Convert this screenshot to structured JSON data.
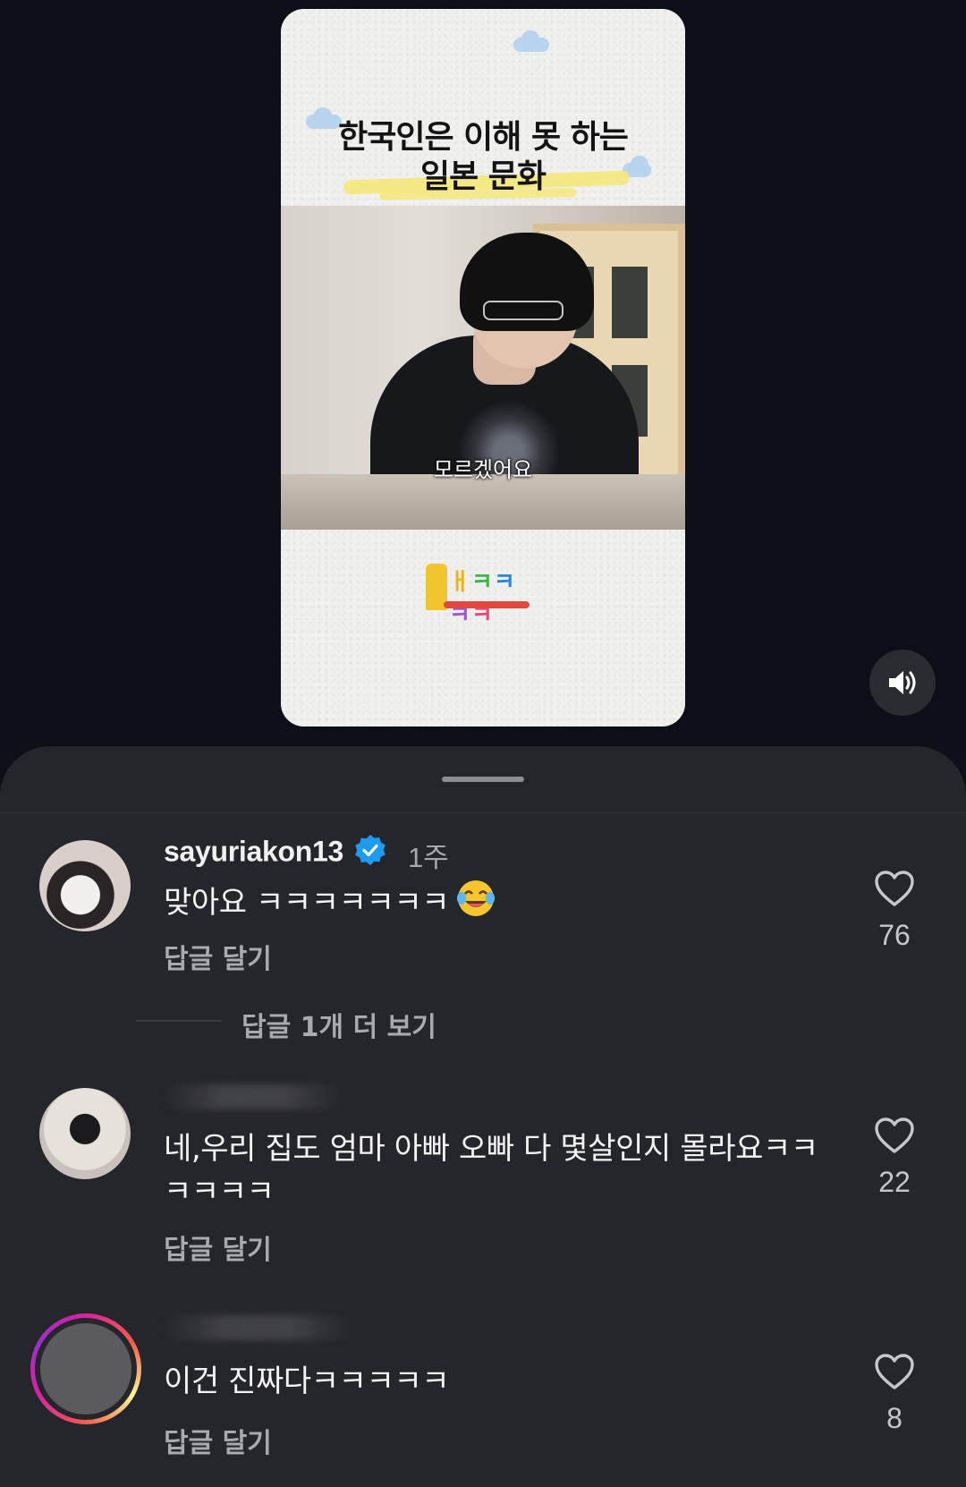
{
  "video": {
    "title_line1": "한국인은 이해 못 하는",
    "title_line2": "일본 문화",
    "subtitle": "모르겠어요",
    "logo_letters": [
      "ㅐ",
      "ㅋ",
      "ㅋ",
      "ㅋ",
      "ㅋ"
    ],
    "volume_icon": "speaker-volume-icon"
  },
  "comments": [
    {
      "username": "sayuriakon13",
      "verified": true,
      "time": "1주",
      "text": "맞아요 ㅋㅋㅋㅋㅋㅋㅋ",
      "emoji": "face-with-tears-of-joy",
      "reply_label": "답글 달기",
      "likes": "76",
      "view_more": "답글 1개 더 보기"
    },
    {
      "username_blurred": true,
      "text": "네,우리 집도 엄마 아빠 오빠 다 몇살인지 몰라요ㅋㅋㅋㅋㅋㅋ",
      "reply_label": "답글 달기",
      "likes": "22"
    },
    {
      "username_blurred": true,
      "has_story_ring": true,
      "text": "이건 진짜다ㅋㅋㅋㅋㅋ",
      "reply_label": "답글 달기",
      "likes": "8"
    }
  ],
  "colors": {
    "background": "#0d1117",
    "sheet": "#25262b",
    "verified_blue": "#1d9bf0",
    "muted_text": "#a9aaaf"
  }
}
